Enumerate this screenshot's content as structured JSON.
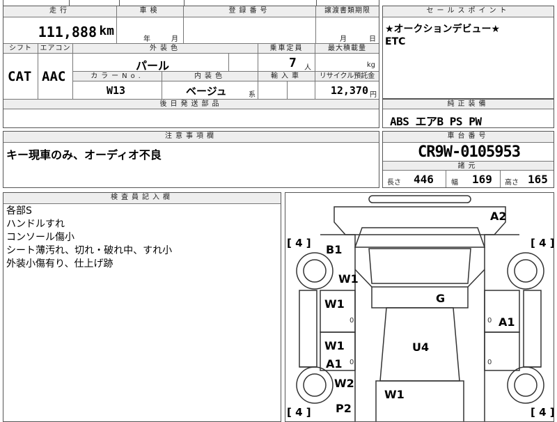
{
  "top_left_stub": "",
  "mileage": {
    "header": "走行",
    "value": "111,888",
    "unit": "km"
  },
  "inspection": {
    "header": "車検",
    "year_unit": "年",
    "month_unit": "月"
  },
  "registration": {
    "header": "登録番号",
    "value": ""
  },
  "transfer": {
    "header": "譲渡書類期限",
    "month_unit": "月",
    "day_unit": "日"
  },
  "shift": {
    "header": "シフト",
    "value": "CAT"
  },
  "aircon": {
    "header": "エアコン",
    "value": "AAC"
  },
  "exterior_color": {
    "header": "外装色",
    "value": "パール"
  },
  "capacity": {
    "header": "乗車定員",
    "value": "7",
    "unit": "人"
  },
  "max_load": {
    "header": "最大積載量",
    "unit": "kg"
  },
  "color_no": {
    "header": "カラーNo.",
    "value": "W13"
  },
  "interior_color": {
    "header": "内装色",
    "value": "ベージュ",
    "suffix": "系"
  },
  "import": {
    "header": "輸入車"
  },
  "recycle": {
    "header": "リサイクル預託金",
    "value": "12,370",
    "unit": "円"
  },
  "shipping_parts": {
    "header": "後日発送部品"
  },
  "sales_point": {
    "header": "セールスポイント",
    "lines": [
      "★オークションデビュー★",
      "ETC"
    ]
  },
  "standard_equipment": {
    "header": "純正装備",
    "value": "ABS エアB PS PW"
  },
  "notes": {
    "header": "注意事項欄",
    "value": "キー現車のみ、オーディオ不良"
  },
  "chassis": {
    "header": "車台番号",
    "value": "CR9W-0105953"
  },
  "specs": {
    "header": "諸元",
    "length_label": "長さ",
    "length": "446",
    "width_label": "幅",
    "width": "169",
    "height_label": "高さ",
    "height": "165"
  },
  "inspector": {
    "header": "検査員記入欄",
    "lines": [
      "各部S",
      "ハンドルすれ",
      "コンソール傷小",
      "シート薄汚れ、切れ・破れ中、すれ小",
      "外装小傷有り、仕上げ跡"
    ]
  },
  "diagram": {
    "tire_labels": [
      "[ 4 ]",
      "[ 4 ]",
      "[ 4 ]",
      "[ 4 ]"
    ],
    "marks": [
      "A2",
      "B1",
      "W1",
      "W1",
      "G",
      "A1",
      "W1",
      "U4",
      "A1",
      "W2",
      "W1",
      "P2"
    ]
  }
}
